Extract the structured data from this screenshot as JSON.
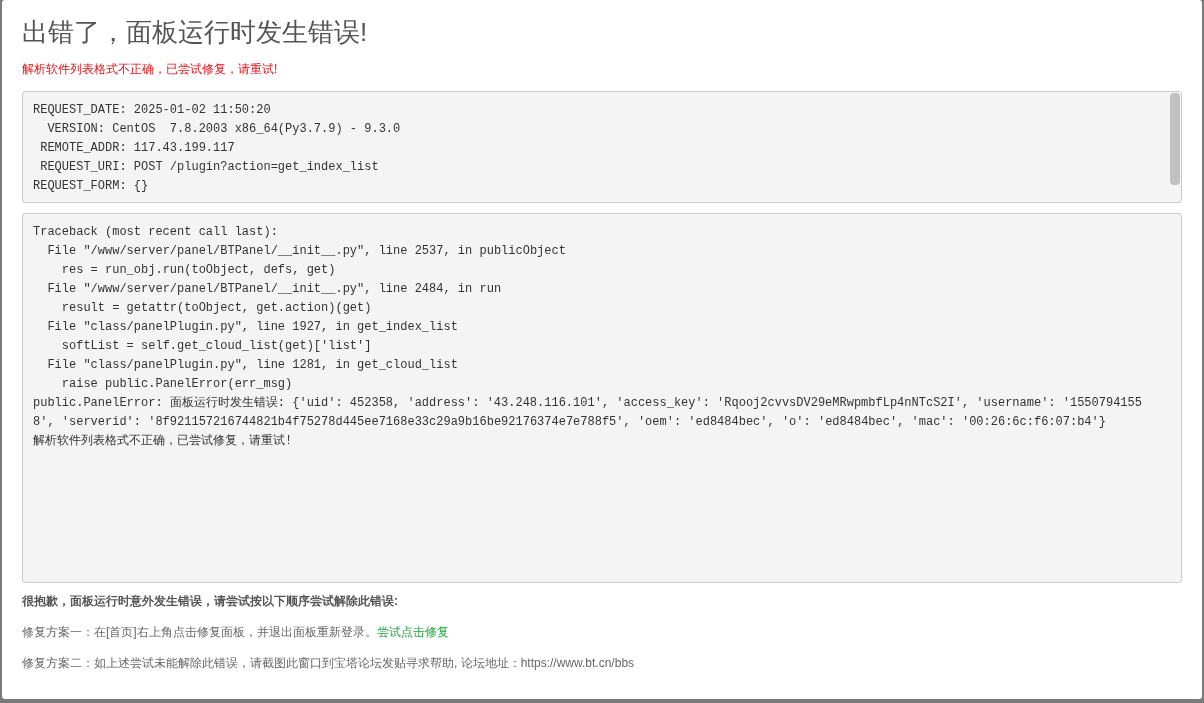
{
  "dialog": {
    "title": "出错了，面板运行时发生错误!",
    "subtitle": "解析软件列表格式不正确，已尝试修复，请重试!",
    "request_info": [
      "REQUEST_DATE: 2025-01-02 11:50:20",
      "  VERSION: CentOS  7.8.2003 x86_64(Py3.7.9) - 9.3.0",
      " REMOTE_ADDR: 117.43.199.117",
      " REQUEST_URI: POST /plugin?action=get_index_list",
      "REQUEST_FORM: {}"
    ],
    "traceback": [
      "Traceback (most recent call last):",
      "  File \"/www/server/panel/BTPanel/__init__.py\", line 2537, in publicObject",
      "    res = run_obj.run(toObject, defs, get)",
      "  File \"/www/server/panel/BTPanel/__init__.py\", line 2484, in run",
      "    result = getattr(toObject, get.action)(get)",
      "  File \"class/panelPlugin.py\", line 1927, in get_index_list",
      "    softList = self.get_cloud_list(get)['list']",
      "  File \"class/panelPlugin.py\", line 1281, in get_cloud_list",
      "    raise public.PanelError(err_msg)",
      "public.PanelError: 面板运行时发生错误: {'uid': 452358, 'address': '43.248.116.101', 'access_key': 'Rqooj2cvvsDV29eMRwpmbfLp4nNTcS2I', 'username': '15507941558', 'serverid': '8f921157216744821b4f75278d445ee7168e33c29a9b16be92176374e7e788f5', 'oem': 'ed8484bec', 'o': 'ed8484bec', 'mac': '00:26:6c:f6:07:b4'}",
      "解析软件列表格式不正确，已尝试修复，请重试!"
    ],
    "apology": "很抱歉，面板运行时意外发生错误，请尝试按以下顺序尝试解除此错误:",
    "fix_1": {
      "text": "修复方案一：在[首页]右上角点击修复面板，并退出面板重新登录。",
      "link": "尝试点击修复"
    },
    "fix_2": "修复方案二：如上述尝试未能解除此错误，请截图此窗口到宝塔论坛发贴寻求帮助, 论坛地址：https://www.bt.cn/bbs"
  }
}
